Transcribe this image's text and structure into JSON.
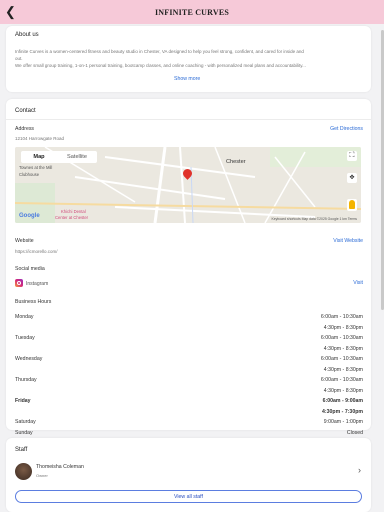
{
  "header": {
    "title": "INFINITE CURVES",
    "back_icon": "back-arrow-icon"
  },
  "about": {
    "heading": "About us",
    "line1": "Infinite Curves is a women-centered fitness and beauty studio in Chester, VA designed to help you feel strong, confident, and cared for inside and",
    "line2": "out.",
    "line3": "We offer small group training, 1-on-1 personal training, bootcamp classes, and online coaching - with personalized meal plans and accountability...",
    "show_more": "Show more"
  },
  "contact": {
    "heading": "Contact",
    "address_label": "Address",
    "address_value": "12104 Harrowgate Road",
    "directions": "Get Directions",
    "map": {
      "tab_map": "Map",
      "tab_satellite": "Satellite",
      "place_chester": "Chester",
      "poi_label": "Chester",
      "poi_sub": "Townes at the Mill",
      "poi_sub2": "Clubhouse",
      "dental1": "Khichi Dental",
      "dental2": "Center at Chester",
      "google": "Google",
      "footer": "Keyboard shortcuts  Map data ©2025 Google  1 km  Terms"
    },
    "website_label": "Website",
    "website_value": "https://icmorello.com/",
    "website_link": "Visit Website",
    "social_label": "Social media",
    "social_item": "Instagram",
    "social_link": "Visit",
    "hours_label": "Business Hours",
    "hours": [
      {
        "day": "Monday",
        "slots": [
          "6:00am - 10:30am",
          "4:30pm - 8:30pm"
        ],
        "bold": false
      },
      {
        "day": "Tuesday",
        "slots": [
          "6:00am - 10:30am",
          "4:30pm - 8:30pm"
        ],
        "bold": false
      },
      {
        "day": "Wednesday",
        "slots": [
          "6:00am - 10:30am",
          "4:30pm - 8:30pm"
        ],
        "bold": false
      },
      {
        "day": "Thursday",
        "slots": [
          "6:00am - 10:30am",
          "4:30pm - 8:30pm"
        ],
        "bold": false
      },
      {
        "day": "Friday",
        "slots": [
          "6:00am - 9:00am",
          "4:30pm - 7:30pm"
        ],
        "bold": true
      },
      {
        "day": "Saturday",
        "slots": [
          "9:00am - 1:00pm"
        ],
        "bold": false
      },
      {
        "day": "Sunday",
        "slots": [
          "Closed"
        ],
        "bold": false
      }
    ]
  },
  "staff": {
    "heading": "Staff",
    "name": "Thomeisha Coleman",
    "role": "Owner",
    "view_all": "View all staff"
  },
  "colors": {
    "topbar": "#f6c9d8",
    "link": "#2b6bd6",
    "pin": "#e0322a"
  }
}
